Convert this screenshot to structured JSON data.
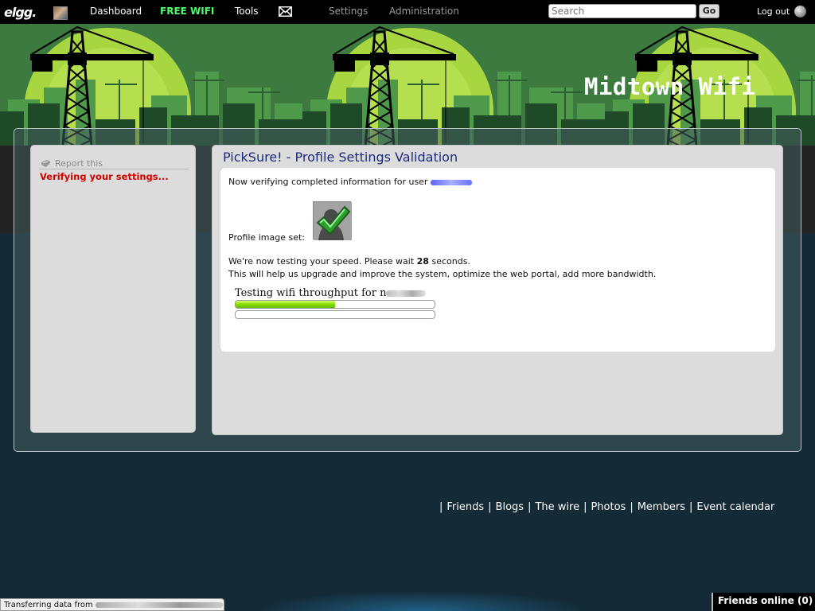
{
  "toolbar": {
    "logo": "elgg.",
    "links": {
      "dashboard": "Dashboard",
      "free_wifi": "FREE WIFI",
      "tools": "Tools",
      "settings": "Settings",
      "administration": "Administration",
      "logout": "Log out"
    },
    "search_placeholder": "Search",
    "go_label": "Go"
  },
  "banner": {
    "title": "Midtown Wifi"
  },
  "sidebar": {
    "report_label": "Report this",
    "status": "Verifying your settings..."
  },
  "content": {
    "title": "PickSure! - Profile Settings Validation",
    "verifying_text": "Now verifying completed information for user",
    "profile_image_label": "Profile image set:",
    "speed_text_before": "We're now testing your speed. Please wait",
    "speed_seconds": "28",
    "speed_text_after": "seconds.",
    "upgrade_text": "This will help us upgrade and improve the system, optimize the web portal, add more bandwidth.",
    "throughput_label": "Testing wifi throughput for",
    "throughput_user_visible": "n",
    "progress": [
      0.5,
      0.0
    ]
  },
  "footer": {
    "links": [
      "Friends",
      "Blogs",
      "The wire",
      "Photos",
      "Members",
      "Event calendar"
    ]
  },
  "statusbar": {
    "text": "Transferring data from"
  },
  "friends_online": "Friends online (0)",
  "colors": {
    "accent_green": "#4cff6a",
    "title_blue": "#1b2a7a",
    "status_red": "#d40000"
  }
}
